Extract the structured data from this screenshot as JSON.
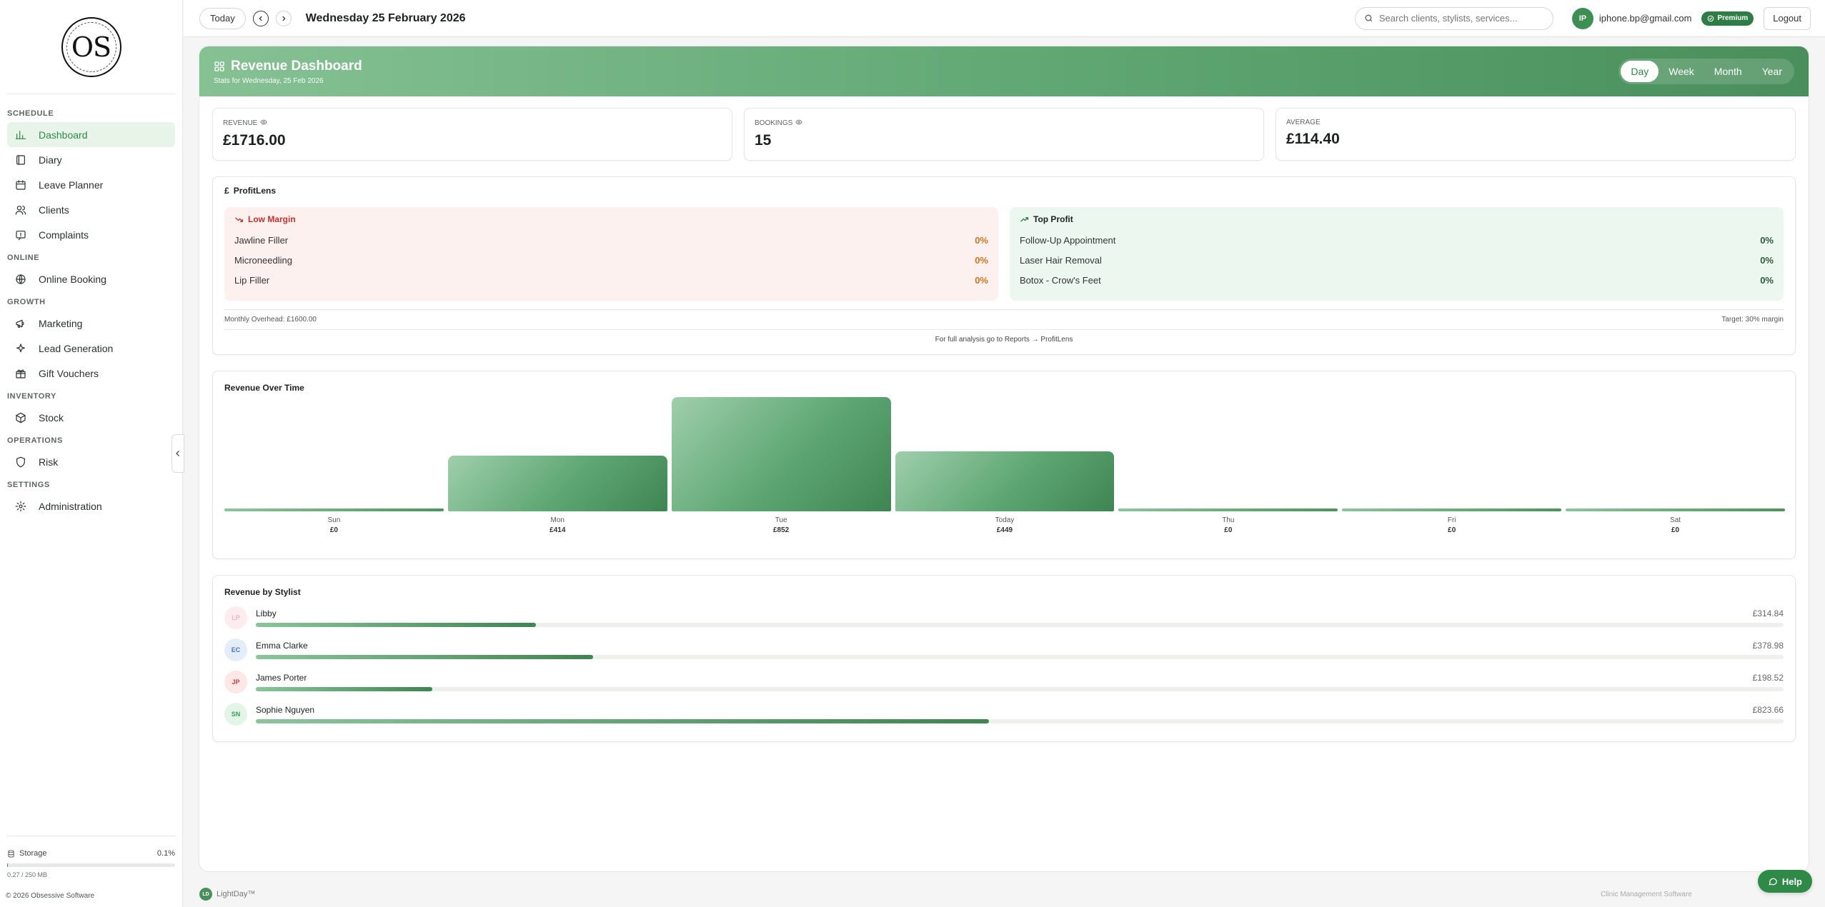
{
  "sidebar": {
    "logo_text": "OS",
    "sections": [
      {
        "title": "SCHEDULE",
        "items": [
          {
            "label": "Dashboard",
            "icon": "bar-chart-icon",
            "active": true
          },
          {
            "label": "Diary",
            "icon": "book-icon"
          },
          {
            "label": "Leave Planner",
            "icon": "calendar-icon"
          },
          {
            "label": "Clients",
            "icon": "users-icon"
          },
          {
            "label": "Complaints",
            "icon": "message-icon"
          }
        ]
      },
      {
        "title": "ONLINE",
        "items": [
          {
            "label": "Online Booking",
            "icon": "globe-icon"
          }
        ]
      },
      {
        "title": "GROWTH",
        "items": [
          {
            "label": "Marketing",
            "icon": "megaphone-icon"
          },
          {
            "label": "Lead Generation",
            "icon": "sparkle-icon"
          },
          {
            "label": "Gift Vouchers",
            "icon": "gift-icon"
          }
        ]
      },
      {
        "title": "INVENTORY",
        "items": [
          {
            "label": "Stock",
            "icon": "box-icon"
          }
        ]
      },
      {
        "title": "OPERATIONS",
        "items": [
          {
            "label": "Risk",
            "icon": "shield-icon"
          }
        ]
      },
      {
        "title": "SETTINGS",
        "items": [
          {
            "label": "Administration",
            "icon": "gear-icon"
          }
        ]
      }
    ],
    "storage": {
      "label": "Storage",
      "percent": "0.1%",
      "fraction": 0.0011,
      "usage": "0.27 / 250 MB"
    },
    "copyright": "© 2026 Obsessive Software"
  },
  "topbar": {
    "today_label": "Today",
    "date": "Wednesday 25 February 2026",
    "search_placeholder": "Search clients, stylists, services...",
    "avatar_initials": "IP",
    "email": "iphone.bp@gmail.com",
    "badge": "Premium",
    "logout": "Logout"
  },
  "banner": {
    "title": "Revenue Dashboard",
    "subtitle": "Stats for Wednesday, 25 Feb 2026",
    "periods": [
      "Day",
      "Week",
      "Month",
      "Year"
    ],
    "active_period": "Day"
  },
  "stats": [
    {
      "label": "REVENUE",
      "value": "£1716.00",
      "eye": true
    },
    {
      "label": "BOOKINGS",
      "value": "15",
      "eye": true
    },
    {
      "label": "AVERAGE",
      "value": "£114.40",
      "eye": false
    }
  ],
  "profitlens": {
    "title": "ProfitLens",
    "low_title": "Low Margin",
    "low": [
      {
        "name": "Jawline Filler",
        "pct": "0%"
      },
      {
        "name": "Microneedling",
        "pct": "0%"
      },
      {
        "name": "Lip Filler",
        "pct": "0%"
      }
    ],
    "top_title": "Top Profit",
    "top": [
      {
        "name": "Follow-Up Appointment",
        "pct": "0%"
      },
      {
        "name": "Laser Hair Removal",
        "pct": "0%"
      },
      {
        "name": "Botox - Crow's Feet",
        "pct": "0%"
      }
    ],
    "overhead": "Monthly Overhead: £1600.00",
    "target": "Target: 30% margin",
    "link_text": "For full analysis go to Reports → ProfitLens"
  },
  "chart_data": {
    "type": "bar",
    "title": "Revenue Over Time",
    "categories": [
      "Sun",
      "Mon",
      "Tue",
      "Today",
      "Thu",
      "Fri",
      "Sat"
    ],
    "values": [
      0,
      414,
      852,
      449,
      0,
      0,
      0
    ],
    "value_labels": [
      "£0",
      "£414",
      "£852",
      "£449",
      "£0",
      "£0",
      "£0"
    ],
    "xlabel": "",
    "ylabel": ""
  },
  "stylists": {
    "title": "Revenue by Stylist",
    "rows": [
      {
        "initials": "LP",
        "name": "Libby",
        "amount": "£314.84",
        "value": 314.84,
        "bg": "#fdecee",
        "fg": "#f1b5bd"
      },
      {
        "initials": "EC",
        "name": "Emma Clarke",
        "amount": "£378.98",
        "value": 378.98,
        "bg": "#e4eefb",
        "fg": "#4a73b5"
      },
      {
        "initials": "JP",
        "name": "James Porter",
        "amount": "£198.52",
        "value": 198.52,
        "bg": "#fde7e7",
        "fg": "#c54343"
      },
      {
        "initials": "SN",
        "name": "Sophie Nguyen",
        "amount": "£823.66",
        "value": 823.66,
        "bg": "#e3f5e8",
        "fg": "#3f9a57"
      }
    ],
    "scale_max": 1716
  },
  "footer": {
    "brand": "LightDay™",
    "brand_logo": "LD",
    "right": "Clinic Management Software"
  },
  "help_label": "Help"
}
